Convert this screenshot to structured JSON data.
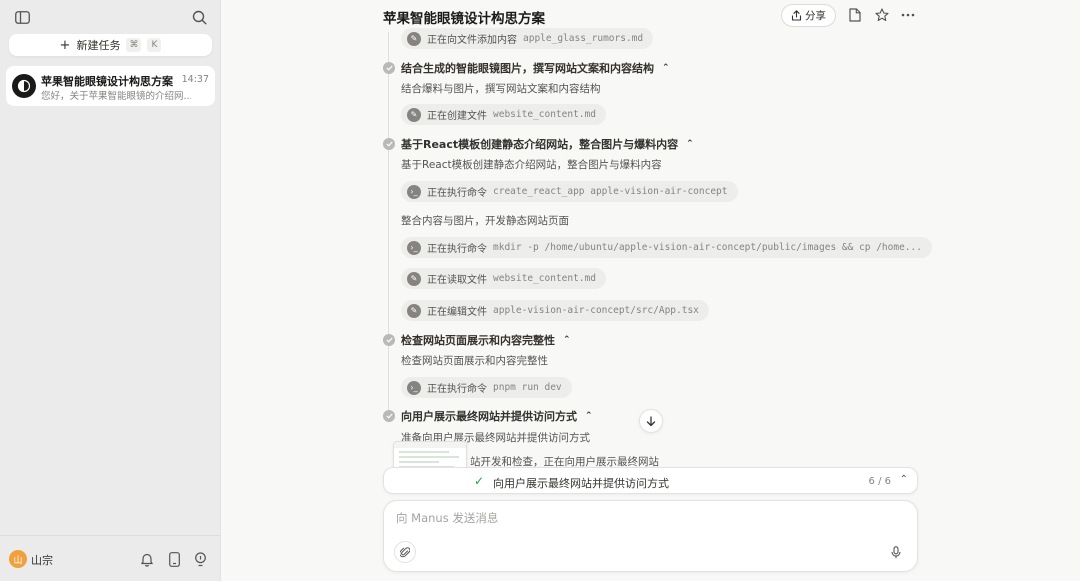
{
  "sidebar": {
    "new_task": {
      "label": "新建任务",
      "shortcut": [
        "⌘",
        "K"
      ]
    },
    "tasks": [
      {
        "title": "苹果智能眼镜设计构思方案",
        "time": "14:37",
        "preview": "您好，关于苹果智能眼镜的介绍网..."
      }
    ],
    "user": {
      "avatar_char": "山",
      "name": "山宗"
    }
  },
  "header": {
    "title": "苹果智能眼镜设计构思方案",
    "share_label": "分享"
  },
  "timeline": {
    "top_pill": {
      "text": "正在向文件添加内容",
      "code": "apple_glass_rumors.md"
    },
    "steps": [
      {
        "title": "结合生成的智能眼镜图片，撰写网站文案和内容结构",
        "desc": "结合爆料与图片，撰写网站文案和内容结构",
        "pills": [
          {
            "text": "正在创建文件",
            "code": "website_content.md"
          }
        ]
      },
      {
        "title": "基于React模板创建静态介绍网站，整合图片与爆料内容",
        "desc": "基于React模板创建静态介绍网站，整合图片与爆料内容",
        "pills": [
          {
            "text": "正在执行命令",
            "code": "create_react_app apple-vision-air-concept"
          }
        ],
        "desc2": "整合内容与图片，开发静态网站页面",
        "pills2": [
          {
            "text": "正在执行命令",
            "code": "mkdir -p /home/ubuntu/apple-vision-air-concept/public/images && cp /home..."
          },
          {
            "text": "正在读取文件",
            "code": "website_content.md"
          },
          {
            "text": "正在编辑文件",
            "code": "apple-vision-air-concept/src/App.tsx"
          }
        ]
      },
      {
        "title": "检查网站页面展示和内容完整性",
        "desc": "检查网站页面展示和内容完整性",
        "pills": [
          {
            "text": "正在执行命令",
            "code": "pnpm run dev"
          }
        ]
      },
      {
        "title": "向用户展示最终网站并提供访问方式",
        "desc": "准备向用户展示最终网站并提供访问方式",
        "desc2": "站开发和检查，正在向用户展示最终网站"
      }
    ]
  },
  "progress": {
    "title": "向用户展示最终网站并提供访问方式",
    "count": "6 / 6"
  },
  "composer": {
    "placeholder": "向 Manus 发送消息"
  },
  "colors": {
    "check_green": "#24a148",
    "user_avatar": "#f0a03c"
  }
}
